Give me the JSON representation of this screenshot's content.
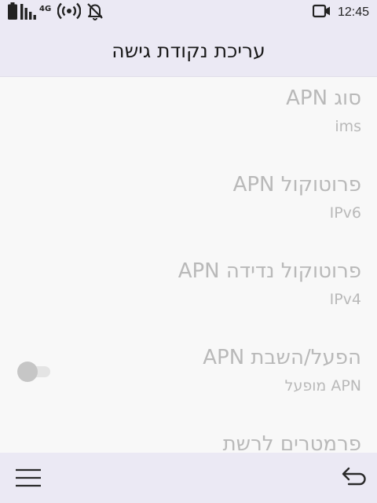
{
  "status_bar": {
    "network_label": "4G",
    "time": "12:45",
    "icons": [
      "battery-icon",
      "signal-icon",
      "hotspot-icon",
      "bell-off-icon",
      "video-icon"
    ]
  },
  "title_bar": {
    "title": "עריכת נקודת גישה"
  },
  "settings": [
    {
      "title": "סוג APN",
      "summary": "ims"
    },
    {
      "title": "פרוטוקול APN",
      "summary": "IPv6"
    },
    {
      "title": "פרוטוקול נדידה APN",
      "summary": "IPv4"
    },
    {
      "title": "הפעל/השבת APN",
      "summary": "APN מופעל",
      "toggle": {
        "on": false
      }
    },
    {
      "title": "פרמטרים לרשת",
      "summary": ""
    }
  ],
  "bottom_bar": {
    "icons": [
      "menu-icon",
      "back-icon"
    ]
  },
  "colors": {
    "bar_background": "#ebe9f4",
    "content_background": "#f8f8f8",
    "disabled_text": "#b9b9b9",
    "primary_text": "#1a1a1a"
  }
}
